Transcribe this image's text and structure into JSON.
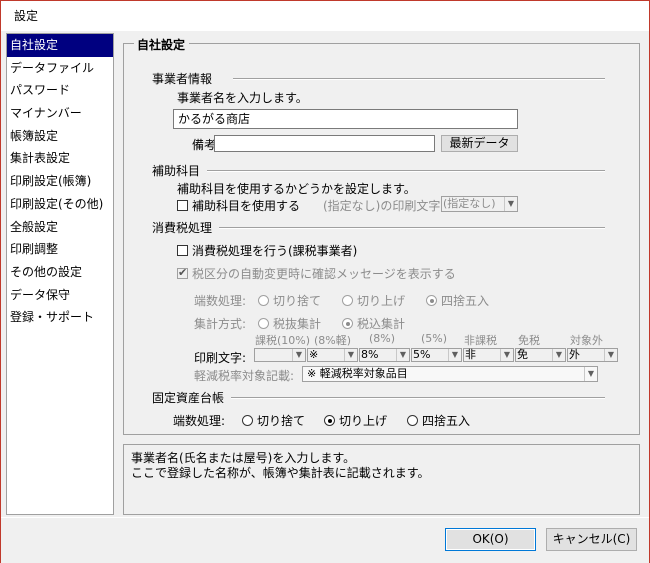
{
  "window": {
    "title": "設定"
  },
  "nav": {
    "items": [
      "自社設定",
      "データファイル",
      "パスワード",
      "マイナンバー",
      "帳簿設定",
      "集計表設定",
      "印刷設定(帳簿)",
      "印刷設定(その他)",
      "全般設定",
      "印刷調整",
      "その他の設定",
      "データ保守",
      "登録・サポート"
    ],
    "active_index": 0
  },
  "company": {
    "group_title": "自社設定",
    "business": {
      "title": "事業者情報",
      "instruction": "事業者名を入力します。",
      "name_value": "かるがる商店",
      "memo_label": "備考:",
      "memo_value": "",
      "latest_button": "最新データ"
    },
    "subaccount": {
      "title": "補助科目",
      "instruction": "補助科目を使用するかどうかを設定します。",
      "use_checkbox": "補助科目を使用する",
      "use_checked": false,
      "print_label": "(指定なし)の印刷文字:",
      "print_value": "(指定なし)"
    },
    "tax": {
      "title": "消費税処理",
      "do_tax_checkbox": "消費税処理を行う(課税事業者)",
      "do_tax_checked": false,
      "confirm_checkbox": "税区分の自動変更時に確認メッセージを表示する",
      "confirm_checked": true,
      "rounding_label": "端数処理:",
      "rounding_options": [
        "切り捨て",
        "切り上げ",
        "四捨五入"
      ],
      "rounding_selected": 2,
      "sum_label": "集計方式:",
      "sum_options": [
        "税抜集計",
        "税込集計"
      ],
      "sum_selected": 1,
      "print_label": "印刷文字:",
      "columns": [
        "課税(10%)",
        "(8%軽)",
        "(8%)",
        "(5%)",
        "非課税",
        "免税",
        "対象外"
      ],
      "column_values": [
        "",
        "※",
        "8%",
        "5%",
        "非",
        "免",
        "外"
      ],
      "reduced_label": "軽減税率対象記載:",
      "reduced_value": "※ 軽減税率対象品目"
    },
    "fixed_assets": {
      "title": "固定資産台帳",
      "rounding_label": "端数処理:",
      "rounding_options": [
        "切り捨て",
        "切り上げ",
        "四捨五入"
      ],
      "rounding_selected": 1
    }
  },
  "description": {
    "line1": "事業者名(氏名または屋号)を入力します。",
    "line2": "ここで登録した名称が、帳簿や集計表に記載されます。"
  },
  "buttons": {
    "ok": "OK(O)",
    "cancel": "キャンセル(C)"
  }
}
